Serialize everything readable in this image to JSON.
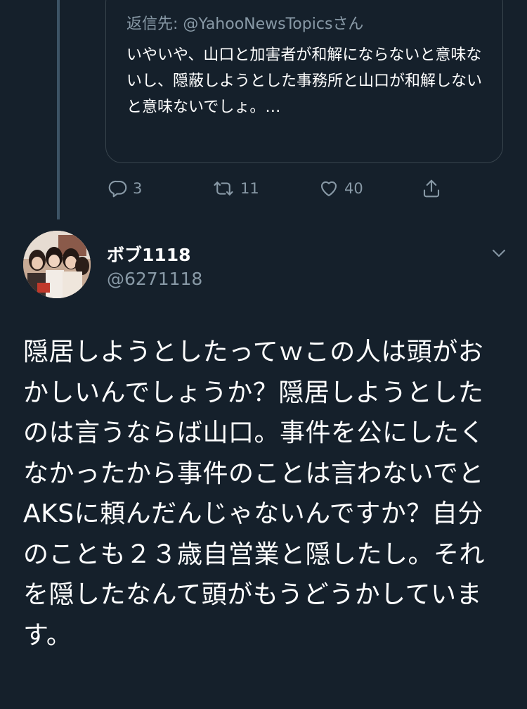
{
  "quoted": {
    "reply_to": "返信先: @YahooNewsTopicsさん",
    "text": "いやいや、山口と加害者が和解にならないと意味ないし、隠蔽しようとした事務所と山口が和解しないと意味ないでしょ。…"
  },
  "actions": {
    "reply_count": "3",
    "retweet_count": "11",
    "like_count": "40"
  },
  "tweet": {
    "display_name": "ボブ1118",
    "handle": "@6271118",
    "text": "隠居しようとしたってｗこの人は頭がおかしいんでしょうか？隠居しようとしたのは言うならば山口。事件を公にしたくなかったから事件のことは言わないでとAKSに頼んだんじゃないんですか？自分のことも２３歳自営業と隠したし。それを隠したなんて頭がもうどうかしています。"
  },
  "icons": [
    "reply-icon",
    "retweet-icon",
    "like-icon",
    "share-icon",
    "chevron-down-icon"
  ],
  "colors": {
    "background": "#15202b",
    "text_primary": "#ffffff",
    "text_secondary": "#8899a6",
    "border": "#38444d"
  }
}
